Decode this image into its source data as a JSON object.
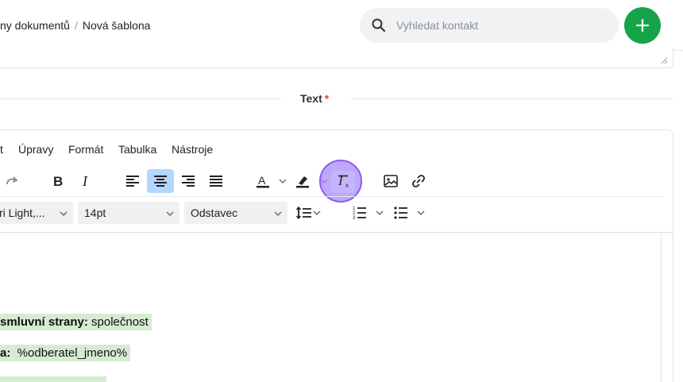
{
  "breadcrumb": {
    "parent": "ny dokumentů",
    "separator": "/",
    "current": "Nová šablona"
  },
  "search": {
    "placeholder": "Vyhledat kontakt"
  },
  "add_button": {
    "label": "+"
  },
  "section": {
    "title": "Text",
    "required_mark": "*"
  },
  "menubar": [
    "t",
    "Úpravy",
    "Formát",
    "Tabulka",
    "Nástroje"
  ],
  "toolbar": {
    "font_family": "ri Light,...",
    "font_size": "14pt",
    "block_format": "Odstavec"
  },
  "content": [
    {
      "bold": "smluvní strany:",
      "text": " společnost"
    },
    {
      "bold": "a:",
      "text": "  %odberatel_jmeno%"
    }
  ],
  "colors": {
    "accent": "#16a34a",
    "highlight": "#d6ecd2",
    "active": "#b4d7ff",
    "focus": "#8b5cf6"
  }
}
